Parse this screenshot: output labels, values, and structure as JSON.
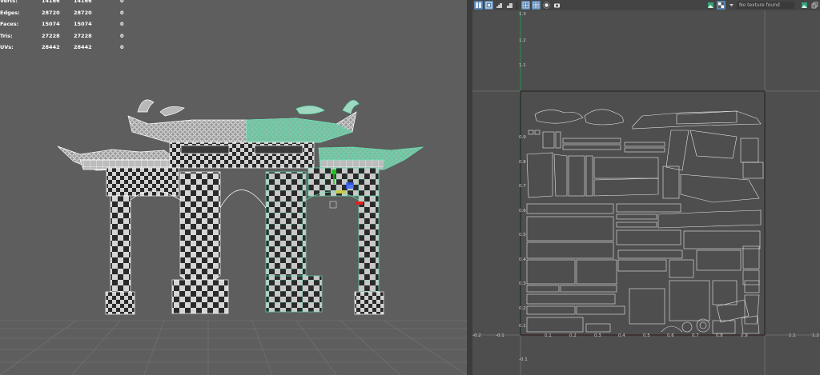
{
  "hud": {
    "rows": [
      {
        "label": "Verts:",
        "v1": "14166",
        "v2": "14166",
        "v3": "0"
      },
      {
        "label": "Edges:",
        "v1": "28720",
        "v2": "28720",
        "v3": "0"
      },
      {
        "label": "Faces:",
        "v1": "15074",
        "v2": "15074",
        "v3": "0"
      },
      {
        "label": "Tris:",
        "v1": "27228",
        "v2": "27228",
        "v3": "0"
      },
      {
        "label": "UVs:",
        "v1": "28442",
        "v2": "28442",
        "v3": "0"
      }
    ]
  },
  "uv_editor": {
    "texture_dropdown": "No texture found",
    "toolbar_icons": [
      "uv-select-icon",
      "uv-shell-icon",
      "stairs-icon",
      "stairs-icon",
      "grid-icon",
      "grid-snap-icon",
      "sun-icon",
      "camera-icon"
    ],
    "toolbar_right_icons": [
      "texture-image-icon",
      "checker-icon",
      "chevron-down-icon"
    ],
    "toolbar_far_right_icons": [
      "texture-image-icon",
      "copy-icon"
    ],
    "axis": {
      "u_ticks": [
        "-0.2",
        "-0.1",
        "0.1",
        "0.2",
        "0.3",
        "0.4",
        "0.5",
        "0.6",
        "0.7",
        "0.8",
        "0.9",
        "1.1",
        "1.2"
      ],
      "v_ticks": [
        "1.3",
        "1.2",
        "1.1",
        "0.9",
        "0.8",
        "0.7",
        "0.6",
        "0.5",
        "0.4",
        "0.3",
        "0.2",
        "0.1",
        "-0.1"
      ]
    },
    "colors": {
      "u_axis": "#b03030",
      "v_axis": "#2e8b4a",
      "grid": "#767676",
      "uv_shell": "#e6e6e6",
      "bound": "#111111"
    }
  },
  "viewport": {
    "colors": {
      "background": "#5e5e5e",
      "ground_grid": "#6f6f6f",
      "selection": "#67e0b0",
      "checker_dark": "#2a2a2a",
      "checker_light": "#d6d6d6",
      "manip_x": "#e02020",
      "manip_y": "#20c020",
      "manip_z": "#3060ff"
    }
  }
}
